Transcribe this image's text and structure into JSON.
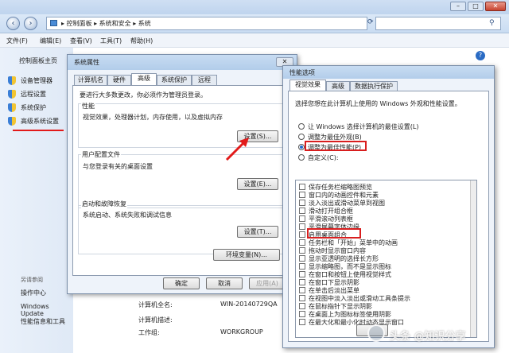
{
  "explorer": {
    "address": "▸ 控制面板  ▸  系统和安全  ▸  系统",
    "menus": [
      "文件(F)",
      "编辑(E)",
      "查看(V)",
      "工具(T)",
      "帮助(H)"
    ],
    "left_title": "控制面板主页",
    "left_links": [
      "设备管理器",
      "远程设置",
      "系统保护",
      "高级系统设置"
    ],
    "see_also_title": "另请参阅",
    "see_also": [
      "操作中心",
      "Windows Update",
      "性能信息和工具"
    ],
    "computer_info": [
      {
        "label": "计算机全名:",
        "value": "WIN-20140729QA"
      },
      {
        "label": "计算机描述:",
        "value": ""
      },
      {
        "label": "工作组:",
        "value": "WORKGROUP"
      }
    ]
  },
  "sysprops": {
    "title": "系统属性",
    "tabs": [
      "计算机名",
      "硬件",
      "高级",
      "系统保护",
      "远程"
    ],
    "notice": "要进行大多数更改，你必须作为管理员登录。",
    "perf_title": "性能",
    "perf_desc": "视觉效果，处理器计划，内存使用，以及虚拟内存",
    "profile_title": "用户配置文件",
    "profile_desc": "与您登录有关的桌面设置",
    "startup_title": "启动和故障恢复",
    "startup_desc": "系统启动、系统失败和调试信息",
    "settings_btn_1": "设置(S)...",
    "settings_btn_2": "设置(E)...",
    "settings_btn_3": "设置(T)...",
    "env_btn": "环境变量(N)...",
    "ok": "确定",
    "cancel": "取消",
    "apply": "应用(A)"
  },
  "perf": {
    "title": "性能选项",
    "tabs": [
      "视觉效果",
      "高级",
      "数据执行保护"
    ],
    "intro": "选择您想在此计算机上使用的 Windows 外观和性能设置。",
    "options": [
      "让 Windows 选择计算机的最佳设置(L)",
      "调整为最佳外观(B)",
      "调整为最佳性能(P)",
      "自定义(C):"
    ],
    "selected_option": 2,
    "items": [
      "保存任务栏缩略图预览",
      "窗口内的动画控件和元素",
      "淡入淡出或滑动菜单到视图",
      "滑动打开组合框",
      "平滑滚动列表框",
      "平滑屏幕字体边缘",
      "启用桌面组合",
      "任务栏和「开始」菜单中的动画",
      "拖动时显示窗口内容",
      "显示亚透明的选择长方形",
      "显示缩略图，而不是显示图标",
      "在窗口和按钮上使用视觉样式",
      "在窗口下显示阴影",
      "在单击后淡出菜单",
      "在视图中淡入淡出或滑动工具条提示",
      "在鼠标指针下显示阴影",
      "在桌面上为图标标签使用阴影",
      "在最大化和最小化时动态显示窗口"
    ],
    "highlighted_item": "启用桌面组合"
  },
  "watermark": "头条 @知识分享"
}
